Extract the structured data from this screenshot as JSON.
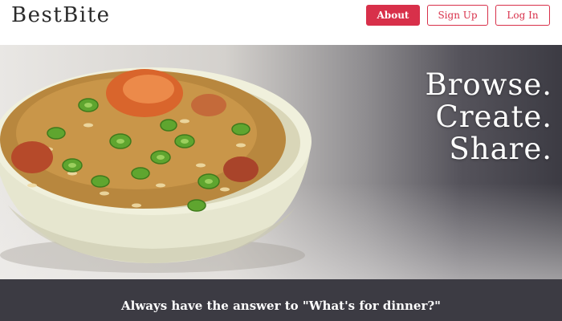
{
  "brand": {
    "name": "BestBite"
  },
  "nav": {
    "about_label": "About",
    "signup_label": "Sign Up",
    "login_label": "Log In"
  },
  "hero": {
    "line1": "Browse.",
    "line2": "Create.",
    "line3": "Share.",
    "image": "bowl of jambalaya with sliced green onions"
  },
  "cta": {
    "text": "Always have the answer to \"What's for dinner?\""
  },
  "colors": {
    "accent": "#d8304a",
    "dark_band": "#3c3b43",
    "text_dark": "#2a2a2a"
  }
}
